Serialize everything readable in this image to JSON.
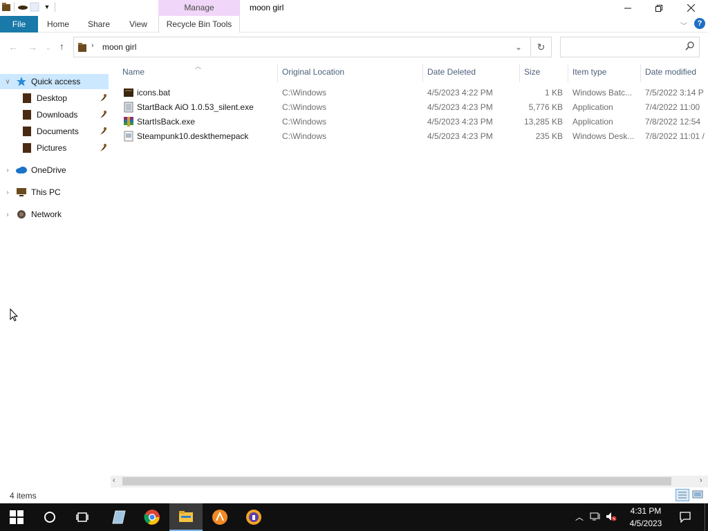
{
  "window": {
    "title": "moon girl",
    "context_tab": "Manage",
    "controls": {
      "minimize": "minimize-icon",
      "restore": "restore-icon",
      "close": "close-icon"
    }
  },
  "ribbon": {
    "tabs": [
      {
        "label": "File"
      },
      {
        "label": "Home"
      },
      {
        "label": "Share"
      },
      {
        "label": "View"
      },
      {
        "label": "Recycle Bin Tools"
      }
    ]
  },
  "address": {
    "path": [
      "moon girl"
    ],
    "search_placeholder": ""
  },
  "navigation": {
    "quick_access": "Quick access",
    "pinned": [
      {
        "label": "Desktop"
      },
      {
        "label": "Downloads"
      },
      {
        "label": "Documents"
      },
      {
        "label": "Pictures"
      }
    ],
    "onedrive": "OneDrive",
    "this_pc": "This PC",
    "network": "Network"
  },
  "columns": [
    "Name",
    "Original Location",
    "Date Deleted",
    "Size",
    "Item type",
    "Date modified"
  ],
  "files": [
    {
      "name": "icons.bat",
      "location": "C:\\Windows",
      "deleted": "4/5/2023 4:22 PM",
      "size": "1 KB",
      "type": "Windows Batc...",
      "modified": "7/5/2022 3:14 P",
      "icon": "batch-file-icon"
    },
    {
      "name": "StartBack AiO 1.0.53_silent.exe",
      "location": "C:\\Windows",
      "deleted": "4/5/2023 4:23 PM",
      "size": "5,776 KB",
      "type": "Application",
      "modified": "7/4/2022 11:00",
      "icon": "executable-icon"
    },
    {
      "name": "StartIsBack.exe",
      "location": "C:\\Windows",
      "deleted": "4/5/2023 4:23 PM",
      "size": "13,285 KB",
      "type": "Application",
      "modified": "7/8/2022 12:54",
      "icon": "archive-exe-icon"
    },
    {
      "name": "Steampunk10.deskthemepack",
      "location": "C:\\Windows",
      "deleted": "4/5/2023 4:23 PM",
      "size": "235 KB",
      "type": "Windows Desk...",
      "modified": "7/8/2022 11:01 /",
      "icon": "themepack-icon"
    }
  ],
  "status": {
    "count": "4 items"
  },
  "taskbar": {
    "time": "4:31 PM",
    "date": "4/5/2023",
    "apps": [
      "start-icon",
      "search-icon",
      "task-view-icon",
      "notepad-icon",
      "chrome-icon",
      "file-explorer-icon",
      "app-orange-icon",
      "app-vpn-icon"
    ]
  },
  "colors": {
    "file_tab": "#1979a9",
    "manage_tab": "#f0d6f8",
    "selected_nav": "#cce8ff",
    "taskbar": "#101010"
  }
}
